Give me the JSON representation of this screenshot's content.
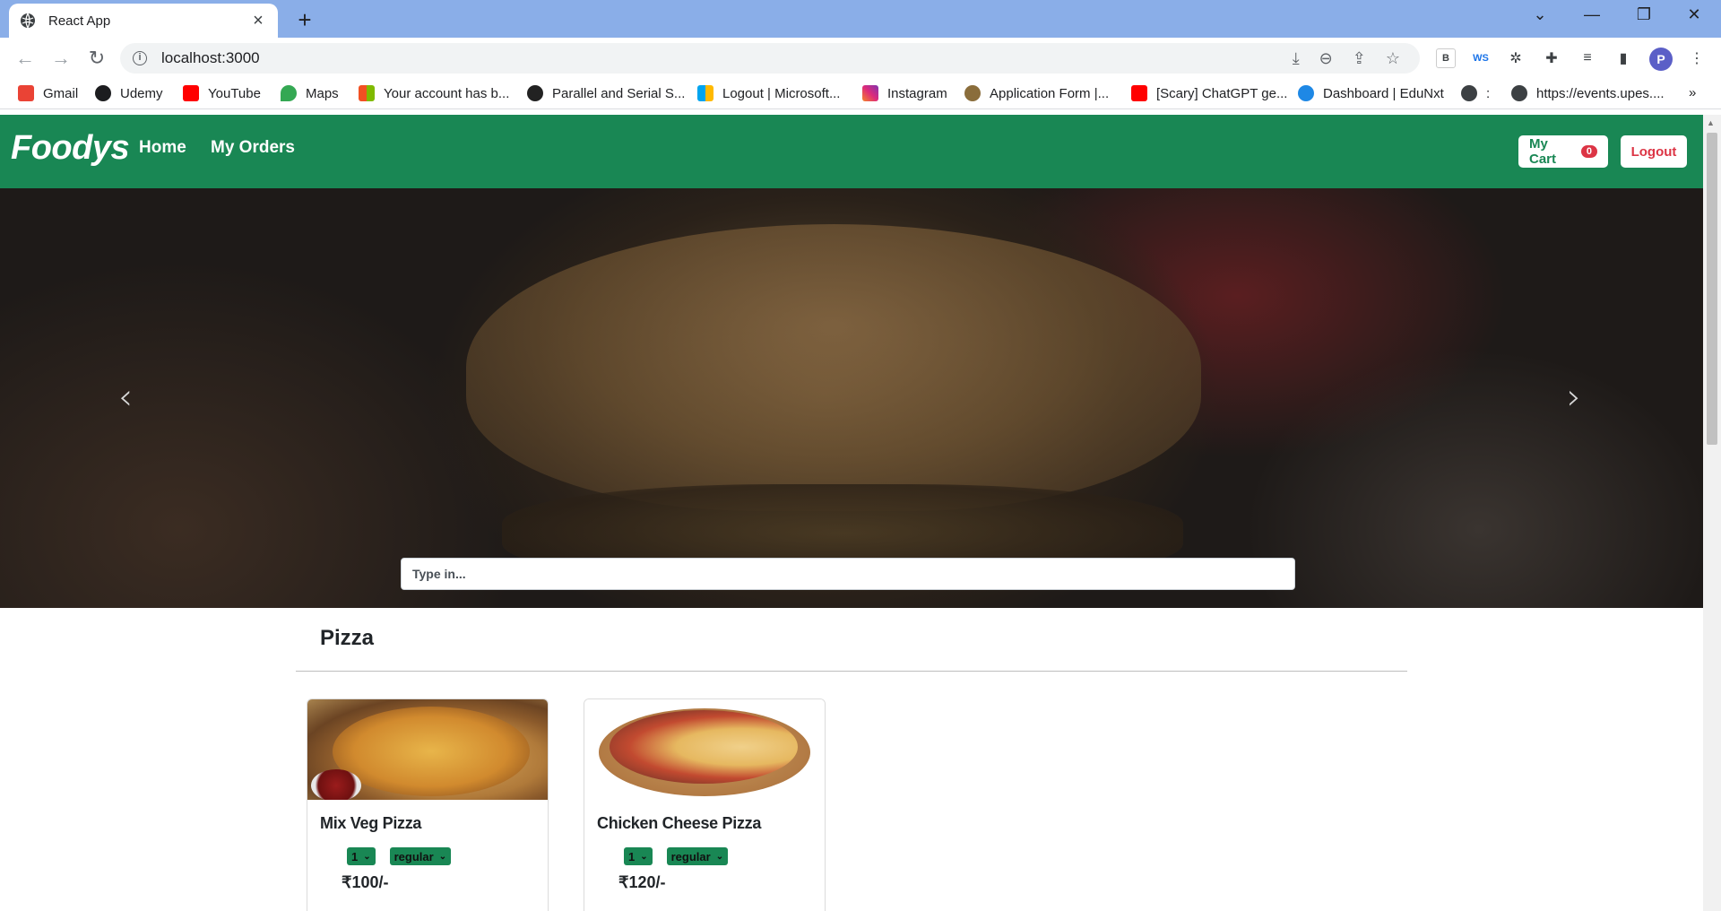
{
  "browser": {
    "tab_title": "React App",
    "new_tab": "+",
    "url": "localhost:3000",
    "profile_initial": "P",
    "bookmarks": [
      {
        "label": "Gmail",
        "color": "#ea4335"
      },
      {
        "label": "Udemy",
        "color": "#1c1d1f"
      },
      {
        "label": "YouTube",
        "color": "#ff0000"
      },
      {
        "label": "Maps",
        "color": "#34a853"
      },
      {
        "label": "Your account has b...",
        "color": "#f25022"
      },
      {
        "label": "Parallel and Serial S...",
        "color": "#222222"
      },
      {
        "label": "Logout | Microsoft...",
        "color": "#7fba00"
      },
      {
        "label": "Instagram",
        "color": "#e1306c"
      },
      {
        "label": "Application Form |...",
        "color": "#8a6d3b"
      },
      {
        "label": "[Scary] ChatGPT ge...",
        "color": "#ff0000"
      },
      {
        "label": "Dashboard | EduNxt",
        "color": "#1e88e5"
      },
      {
        "label": ":",
        "color": "#3c4043"
      },
      {
        "label": "https://events.upes....",
        "color": "#3c4043"
      }
    ],
    "more_bookmarks": "»"
  },
  "navbar": {
    "brand": "Foodys",
    "links": [
      "Home",
      "My Orders"
    ],
    "cart_label": "My Cart",
    "cart_count": "0",
    "logout_label": "Logout",
    "accent_color": "#198754"
  },
  "carousel": {
    "prev": "‹",
    "next": "›",
    "search_placeholder": "Type in..."
  },
  "category": {
    "title": "Pizza",
    "items": [
      {
        "name": "Mix Veg Pizza",
        "qty": "1",
        "size": "regular",
        "price": "₹100/-"
      },
      {
        "name": "Chicken Cheese Pizza",
        "qty": "1",
        "size": "regular",
        "price": "₹120/-"
      }
    ]
  }
}
